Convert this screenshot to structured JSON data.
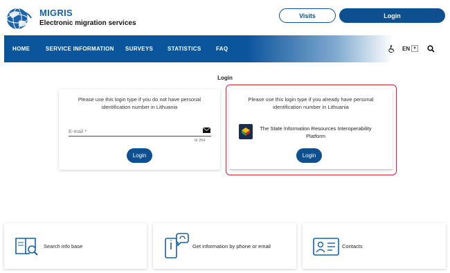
{
  "brand": {
    "title": "MIGRIS",
    "subtitle": "Electronic migration services"
  },
  "header": {
    "visits_label": "Visits",
    "login_label": "Login"
  },
  "nav": {
    "items": [
      "HOME",
      "SERVICE INFORMATION",
      "SURVEYS",
      "STATISTICS",
      "FAQ"
    ],
    "language": "EN"
  },
  "page_title": "Login",
  "card_email": {
    "description": "Please use this login type if you do not have personal identification number in Lithuania",
    "email_placeholder": "E-mail *",
    "counter": "0/ 254",
    "button_label": "Login"
  },
  "card_viisp": {
    "description": "Please use this login type if you already have personal identification number in Lithuania",
    "provider_label": "The State Information Resources Interoperability Platform",
    "button_label": "Login"
  },
  "tiles": [
    {
      "label": "Search info base",
      "icon": "book-search-icon"
    },
    {
      "label": "Get information by phone or email",
      "icon": "phone-chat-icon"
    },
    {
      "label": "Contacts",
      "icon": "contact-card-icon"
    }
  ],
  "colors": {
    "primary": "#0d4f8f",
    "nav": "#0b559d",
    "highlight": "#d9232d"
  }
}
